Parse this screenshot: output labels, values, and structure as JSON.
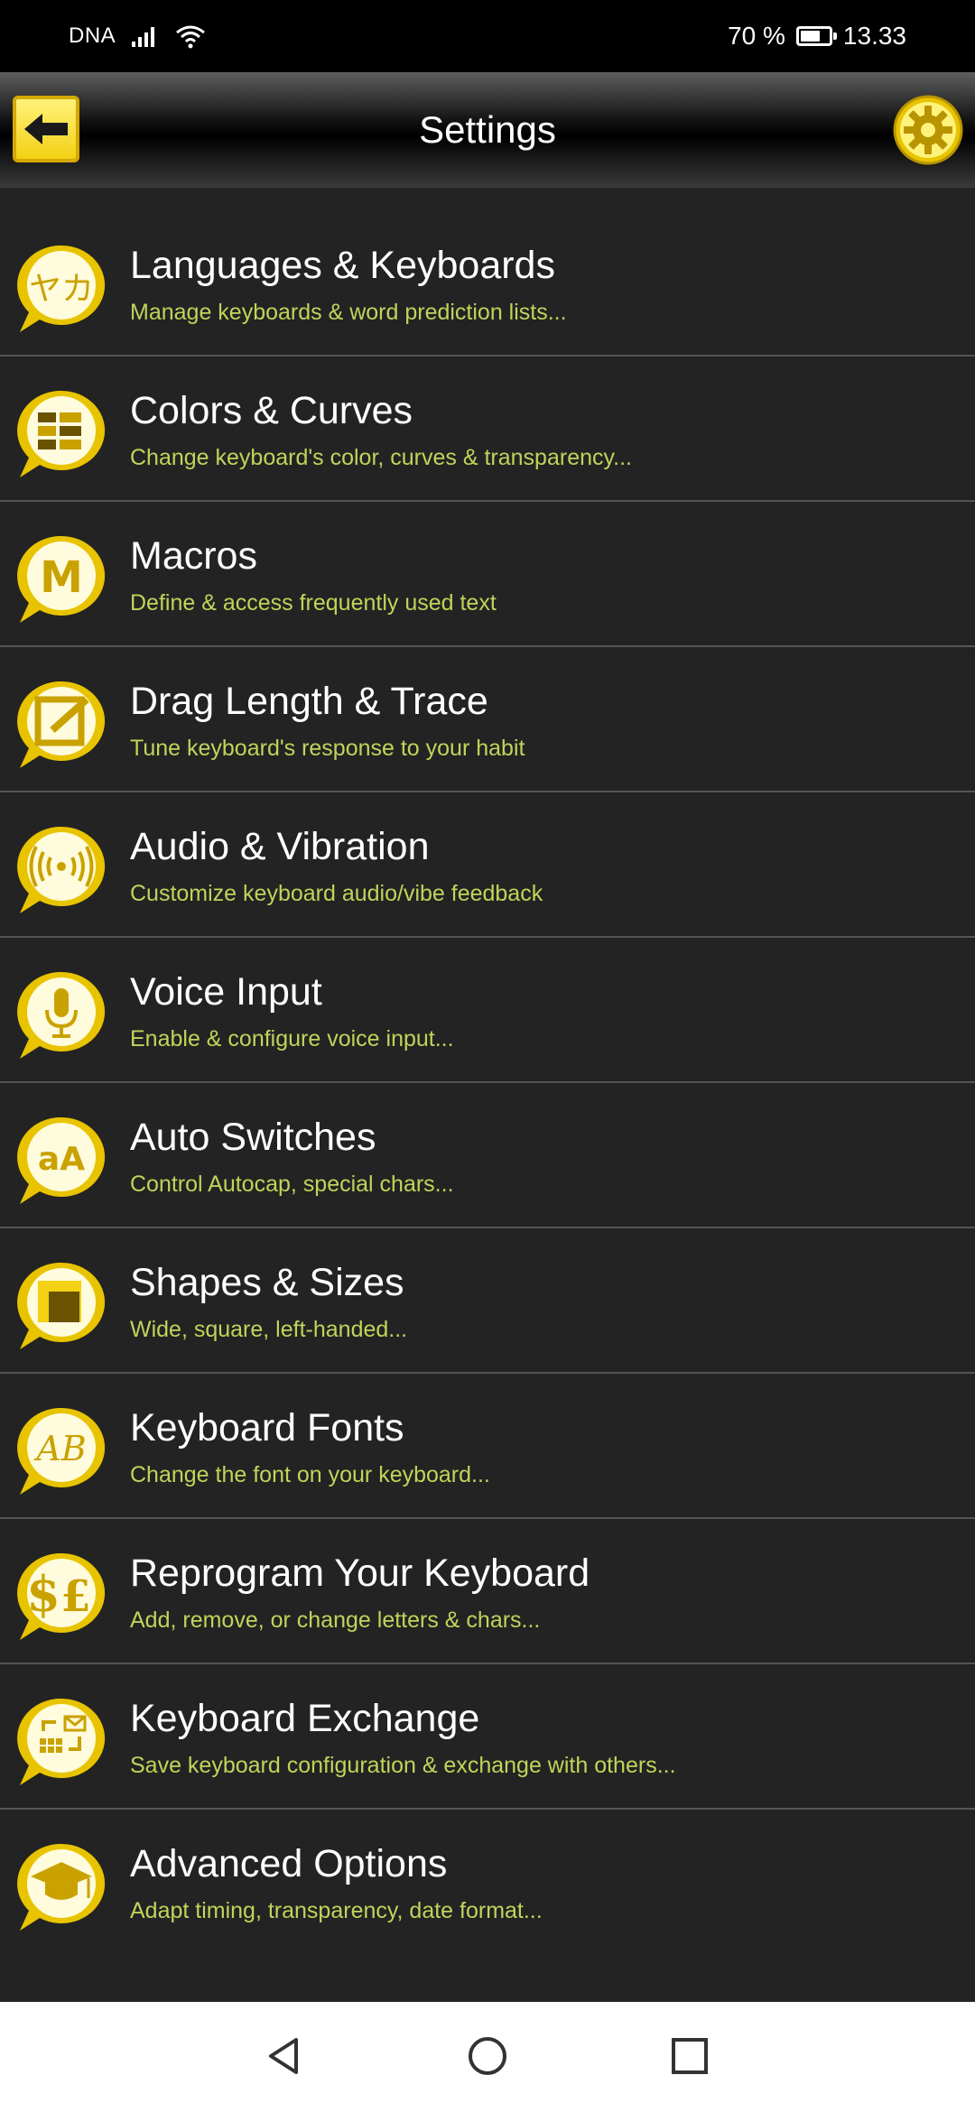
{
  "status_bar": {
    "carrier": "DNA",
    "battery_percent": "70 %",
    "battery_level": 0.7,
    "time": "13.33"
  },
  "app_bar": {
    "title": "Settings",
    "back_icon": "back-arrow-icon",
    "settings_icon": "gear-icon"
  },
  "accent_color": "#f3d114",
  "subtitle_color": "#c0d45a",
  "items": [
    {
      "title": "Languages & Keyboards",
      "subtitle": "Manage keyboards & word prediction lists...",
      "icon": "languages-icon"
    },
    {
      "title": "Colors & Curves",
      "subtitle": "Change keyboard's color, curves & transparency...",
      "icon": "palette-grid-icon"
    },
    {
      "title": "Macros",
      "subtitle": "Define & access frequently used text",
      "icon": "macros-m-icon"
    },
    {
      "title": "Drag Length & Trace",
      "subtitle": "Tune keyboard's response to your habit",
      "icon": "edit-pen-icon"
    },
    {
      "title": "Audio & Vibration",
      "subtitle": "Customize keyboard audio/vibe feedback",
      "icon": "vibration-icon"
    },
    {
      "title": "Voice Input",
      "subtitle": "Enable & configure voice input...",
      "icon": "microphone-icon"
    },
    {
      "title": "Auto Switches",
      "subtitle": "Control Autocap, special chars...",
      "icon": "case-aa-icon"
    },
    {
      "title": "Shapes & Sizes",
      "subtitle": "Wide, square, left-handed...",
      "icon": "square-shape-icon"
    },
    {
      "title": "Keyboard Fonts",
      "subtitle": "Change the font on your keyboard...",
      "icon": "font-ab-icon"
    },
    {
      "title": "Reprogram Your Keyboard",
      "subtitle": "Add, remove, or change letters & chars...",
      "icon": "currency-icon"
    },
    {
      "title": "Keyboard Exchange",
      "subtitle": "Save keyboard configuration & exchange with others...",
      "icon": "exchange-icon"
    },
    {
      "title": "Advanced Options",
      "subtitle": "Adapt timing, transparency, date format...",
      "icon": "graduation-cap-icon"
    }
  ],
  "nav_bar": {
    "back_icon": "nav-back-icon",
    "home_icon": "nav-home-icon",
    "recents_icon": "nav-recents-icon"
  }
}
